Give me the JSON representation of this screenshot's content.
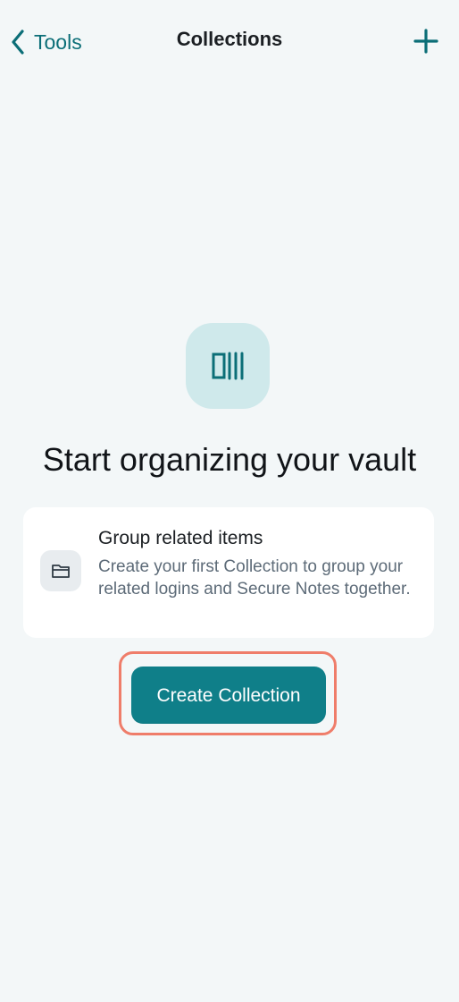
{
  "header": {
    "back_label": "Tools",
    "title": "Collections"
  },
  "icons": {
    "back": "chevron-left-icon",
    "add": "plus-icon",
    "collection": "collection-icon",
    "folder": "folder-icon"
  },
  "empty_state": {
    "headline": "Start organizing your vault",
    "card": {
      "title": "Group related items",
      "body": "Create your first Collection to group your related logins and Secure Notes together."
    },
    "cta_label": "Create Collection"
  },
  "colors": {
    "background": "#f3f7f8",
    "accent": "#0f7f89",
    "accent_text": "#0b6e77",
    "icon_tile": "#cfe9eb",
    "highlight": "#ef7d6a",
    "card_bg": "#ffffff",
    "secondary_text": "#5d6b78"
  }
}
